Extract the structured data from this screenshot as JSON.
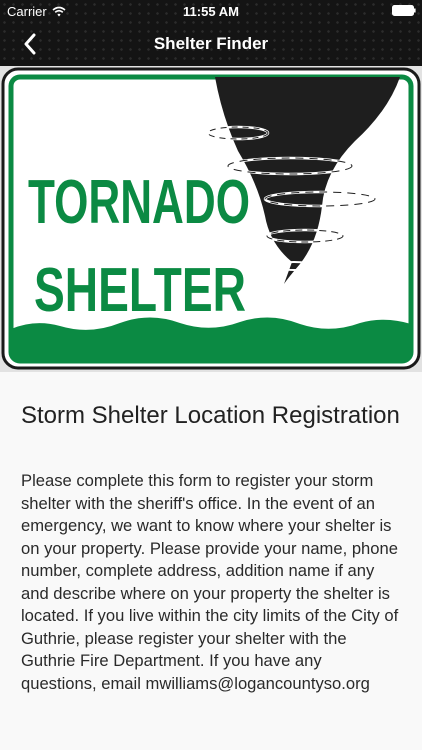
{
  "status_bar": {
    "carrier": "Carrier",
    "time": "11:55 AM",
    "wifi_icon": "wifi-icon",
    "battery_icon": "battery-icon"
  },
  "nav": {
    "title": "Shelter Finder",
    "back_icon": "chevron-left-icon"
  },
  "sign": {
    "line1": "TORNADO",
    "line2": "SHELTER",
    "text_color": "#0b8a43",
    "border_color": "#0b8a43"
  },
  "content": {
    "title": "Storm Shelter Location Registration",
    "body": "Please complete this form to register your storm shelter with the sheriff's office. In the event of an emergency, we want to know where your shelter is on your property. Please provide your name, phone number, complete address, addition name if any and describe where on your property the shelter is located. If you live within the city limits of the City of Guthrie, please register your shelter with the Guthrie Fire Department. If you have any questions, email mwilliams@logancountyso.org"
  },
  "colors": {
    "nav_background": "#141414",
    "sign_green": "#0b8a43",
    "tornado": "#1e1e1e"
  }
}
